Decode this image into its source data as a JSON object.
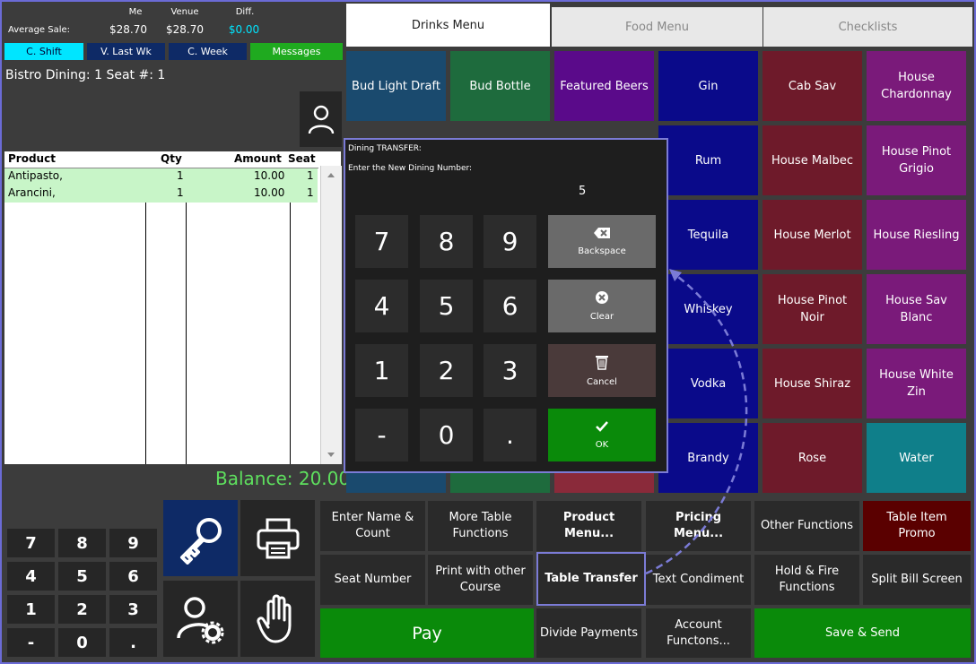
{
  "stats": {
    "average_sale_label": "Average Sale:",
    "col_me": "Me",
    "col_venue": "Venue",
    "col_diff": "Diff.",
    "me_value": "$28.70",
    "venue_value": "$28.70",
    "diff_value": "$0.00"
  },
  "period_buttons": {
    "c_shift": "C. Shift",
    "v_last_wk": "V. Last Wk",
    "c_week": "C. Week",
    "messages": "Messages"
  },
  "table_info": "Bistro Dining: 1  Seat #: 1",
  "order_table": {
    "headers": {
      "product": "Product",
      "qty": "Qty",
      "amount": "Amount",
      "seat": "Seat"
    },
    "rows": [
      {
        "product": "Antipasto,",
        "qty": "1",
        "amount": "10.00",
        "seat": "1"
      },
      {
        "product": "Arancini,",
        "qty": "1",
        "amount": "10.00",
        "seat": "1"
      }
    ]
  },
  "balance": "Balance: 20.00",
  "tabs": {
    "drinks": "Drinks Menu",
    "food": "Food Menu",
    "checklists": "Checklists"
  },
  "menu_items": {
    "bud_light_draft": "Bud Light Draft",
    "bud_bottle": "Bud Bottle",
    "featured_beers": "Featured Beers",
    "gin": "Gin",
    "cab_sav": "Cab Sav",
    "house_chardonnay": "House Chardonnay",
    "rum": "Rum",
    "house_malbec": "House Malbec",
    "house_pinot_grigio": "House Pinot Grigio",
    "tequila": "Tequila",
    "house_merlot": "House Merlot",
    "house_riesling": "House Riesling",
    "whiskey": "Whiskey",
    "house_pinot_noir": "House Pinot Noir",
    "house_sav_blanc": "House Sav Blanc",
    "vodka": "Vodka",
    "house_shiraz": "House Shiraz",
    "house_white_zin": "House White Zin",
    "brandy": "Brandy",
    "rose": "Rose",
    "water": "Water"
  },
  "dialog": {
    "title": "Dining TRANSFER:",
    "prompt": "Enter the New Dining Number:",
    "value": "5",
    "keys": [
      "7",
      "8",
      "9",
      "4",
      "5",
      "6",
      "1",
      "2",
      "3",
      "-",
      "0",
      "."
    ],
    "backspace": "Backspace",
    "clear": "Clear",
    "cancel": "Cancel",
    "ok": "OK"
  },
  "functions": {
    "enter_name_count": "Enter Name & Count",
    "more_table_functions": "More Table Functions",
    "product_menu": "Product Menu...",
    "pricing_menu": "Pricing Menu...",
    "other_functions": "Other Functions",
    "table_item_promo": "Table Item Promo",
    "seat_number": "Seat Number",
    "print_other_course": "Print with other Course",
    "table_transfer": "Table Transfer",
    "text_condiment": "Text Condiment",
    "hold_fire": "Hold & Fire Functions",
    "split_bill": "Split Bill Screen",
    "pay": "Pay",
    "divide_payments": "Divide Payments",
    "account_functions": "Account Functons...",
    "save_send": "Save & Send"
  },
  "keypad": [
    "7",
    "8",
    "9",
    "4",
    "5",
    "6",
    "1",
    "2",
    "3",
    "-",
    "0",
    "."
  ],
  "colors": {
    "accent_cyan": "#00e5ff",
    "blue_button": "#0e2a66",
    "green_button": "#0a8a0a",
    "balance_green": "#5ee05e",
    "dialog_border": "#7b7bd6"
  }
}
